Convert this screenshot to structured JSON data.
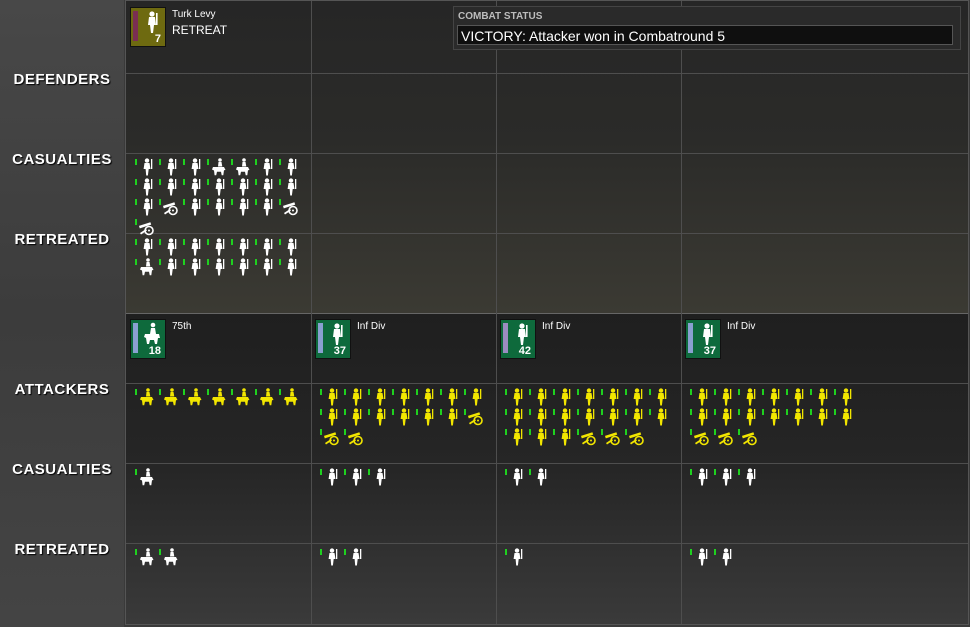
{
  "labels": {
    "defenders": "DEFENDERS",
    "def_casualties": "CASUALTIES",
    "def_retreated": "RETREATED",
    "attackers": "ATTACKERS",
    "att_casualties": "CASUALTIES",
    "att_retreated": "RETREATED"
  },
  "combat_status": {
    "title": "COMBAT STATUS",
    "message": "VICTORY: Attacker won in Combatround  5"
  },
  "defender_units": [
    {
      "name": "Turk Levy",
      "status": "RETREAT",
      "strength": "7",
      "box_color": "#6e6a10",
      "strip_color": "#7a2e52",
      "icon": "infantry-icon"
    }
  ],
  "attacker_units": [
    {
      "name": "75th",
      "strength": "18",
      "box_color": "#0e6a3c",
      "strip_color": "#8aa0d0",
      "icon": "cavalry-icon"
    },
    {
      "name": "Inf Div",
      "strength": "37",
      "box_color": "#0e6a3c",
      "strip_color": "#8aa0d0",
      "icon": "infantry-icon"
    },
    {
      "name": "Inf Div",
      "strength": "42",
      "box_color": "#0e6a3c",
      "strip_color": "#9a8cc0",
      "icon": "infantry-icon"
    },
    {
      "name": "Inf Div",
      "strength": "37",
      "box_color": "#0e6a3c",
      "strip_color": "#8aa0d0",
      "icon": "infantry-icon"
    }
  ],
  "colors": {
    "defender_icon": "#ffffff",
    "attacker_icon": "#f2e600",
    "casualty_icon": "#ffffff",
    "strength_tick": "#1fd11f"
  },
  "defender_casualties": [
    [
      "infantry",
      "infantry",
      "infantry",
      "cavalry",
      "cavalry",
      "infantry",
      "infantry",
      "infantry",
      "infantry",
      "infantry",
      "infantry",
      "infantry",
      "infantry",
      "infantry",
      "infantry",
      "artillery",
      "infantry",
      "infantry",
      "infantry",
      "infantry",
      "artillery",
      "artillery"
    ]
  ],
  "defender_retreated": [
    [
      "infantry",
      "infantry",
      "infantry",
      "infantry",
      "infantry",
      "infantry",
      "infantry",
      "cavalry",
      "infantry",
      "infantry",
      "infantry",
      "infantry",
      "infantry",
      "infantry"
    ]
  ],
  "attacker_troops": [
    [
      "cavalry",
      "cavalry",
      "cavalry",
      "cavalry",
      "cavalry",
      "cavalry",
      "cavalry"
    ],
    [
      "infantry",
      "infantry",
      "infantry",
      "infantry",
      "infantry",
      "infantry",
      "infantry",
      "infantry",
      "infantry",
      "infantry",
      "infantry",
      "infantry",
      "infantry",
      "artillery",
      "artillery",
      "artillery"
    ],
    [
      "infantry",
      "infantry",
      "infantry",
      "infantry",
      "infantry",
      "infantry",
      "infantry",
      "infantry",
      "infantry",
      "infantry",
      "infantry",
      "infantry",
      "infantry",
      "infantry",
      "infantry",
      "infantry",
      "infantry",
      "artillery",
      "artillery",
      "artillery"
    ],
    [
      "infantry",
      "infantry",
      "infantry",
      "infantry",
      "infantry",
      "infantry",
      "infantry",
      "infantry",
      "infantry",
      "infantry",
      "infantry",
      "infantry",
      "infantry",
      "infantry",
      "artillery",
      "artillery",
      "artillery"
    ]
  ],
  "attacker_casualties": [
    [
      "cavalry"
    ],
    [
      "infantry",
      "infantry",
      "infantry"
    ],
    [
      "infantry",
      "infantry"
    ],
    [
      "infantry",
      "infantry",
      "infantry"
    ]
  ],
  "attacker_retreated": [
    [
      "cavalry",
      "cavalry"
    ],
    [
      "infantry",
      "infantry"
    ],
    [
      "infantry"
    ],
    [
      "infantry",
      "infantry"
    ]
  ]
}
